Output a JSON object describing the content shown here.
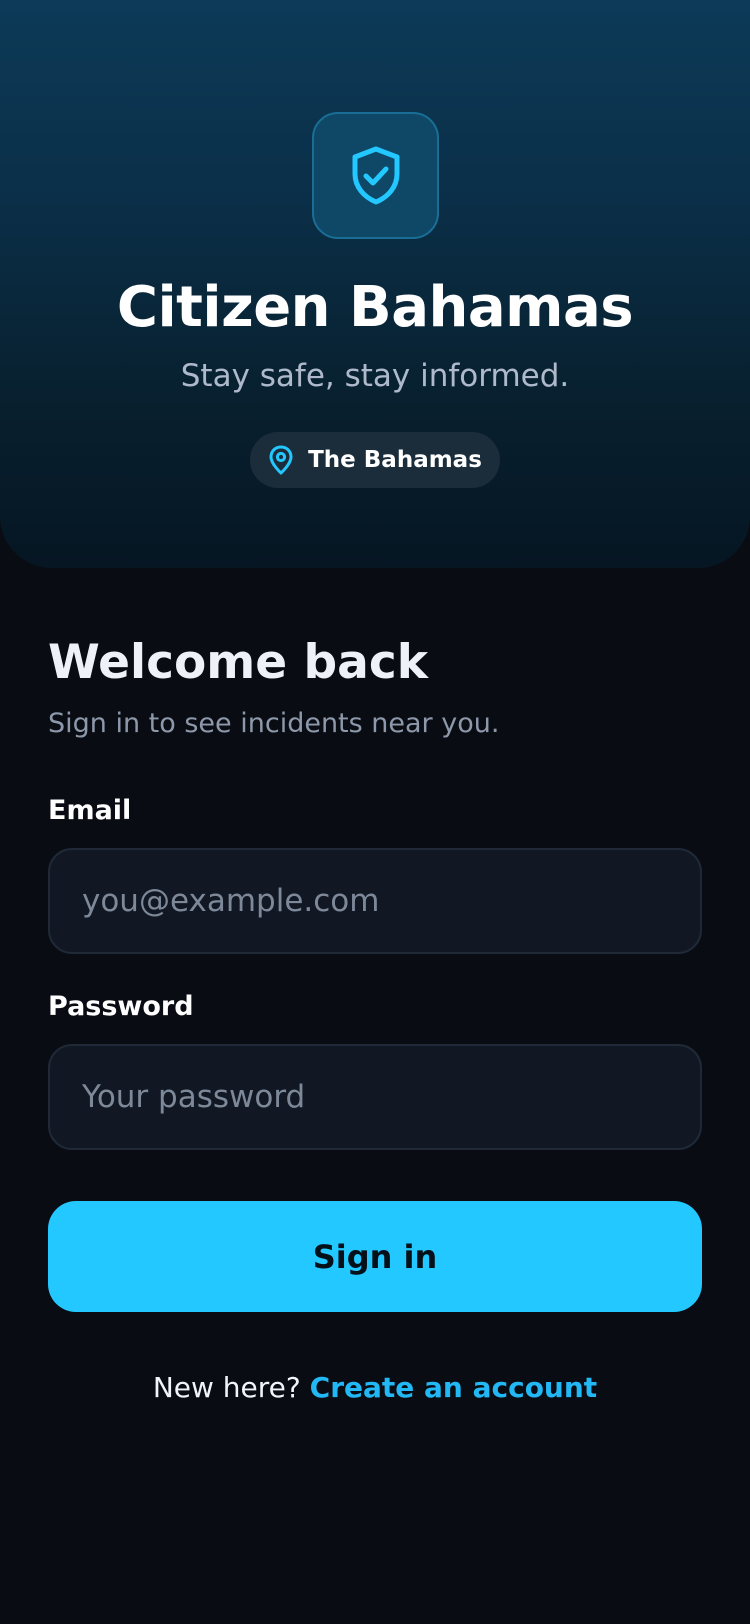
{
  "colors": {
    "accent": "#22c8ff",
    "link": "#22b8f5",
    "background": "#090d13",
    "hero_top": "#0c3a58",
    "hero_bottom": "#061623"
  },
  "hero": {
    "logo_icon": "shield-check-icon",
    "title": "Citizen Bahamas",
    "tagline": "Stay safe, stay informed.",
    "location": {
      "icon": "map-pin-icon",
      "label": "The Bahamas"
    }
  },
  "signin": {
    "title": "Welcome back",
    "subtitle": "Sign in to see incidents near you.",
    "email": {
      "label": "Email",
      "value": "",
      "placeholder": "you@example.com"
    },
    "password": {
      "label": "Password",
      "value": "",
      "placeholder": "Your password"
    },
    "submit_label": "Sign in",
    "signup_prompt": "New here? ",
    "signup_link": "Create an account"
  }
}
